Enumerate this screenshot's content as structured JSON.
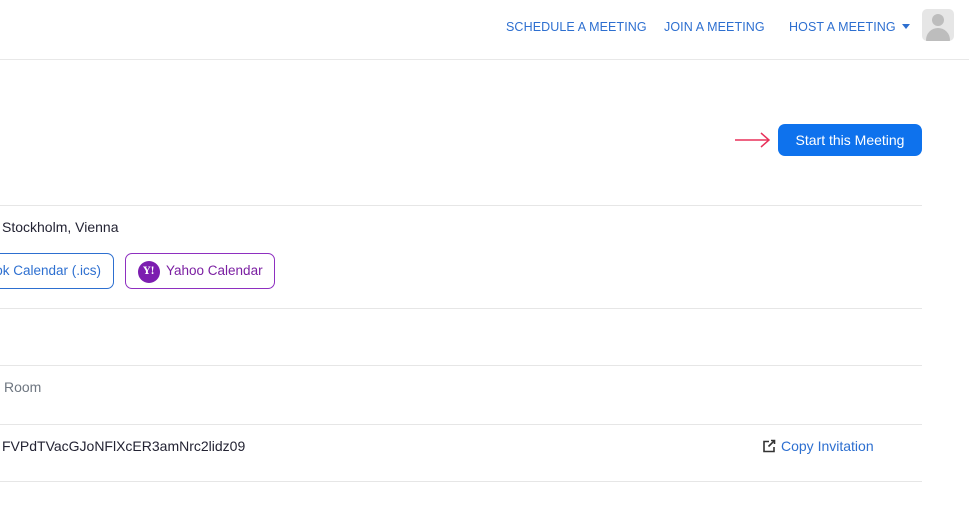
{
  "nav": {
    "schedule": "SCHEDULE A MEETING",
    "join": "JOIN A MEETING",
    "host": "HOST A MEETING"
  },
  "actions": {
    "start_meeting": "Start this Meeting"
  },
  "timezone": {
    "text": "Stockholm, Vienna"
  },
  "calendar": {
    "outlook_label": "ok Calendar (.ics)",
    "yahoo_label": "Yahoo Calendar",
    "yahoo_icon_text": "Y!"
  },
  "room": {
    "text": "Room"
  },
  "invite": {
    "passcode_text": "FVPdTVacGJoNFlXcER3amNrc2lidz09",
    "copy_label": "Copy Invitation"
  },
  "colors": {
    "accent": "#0e72ed",
    "link": "#2d6fd0",
    "yahoo": "#7c1db0",
    "arrow": "#e8315a"
  }
}
